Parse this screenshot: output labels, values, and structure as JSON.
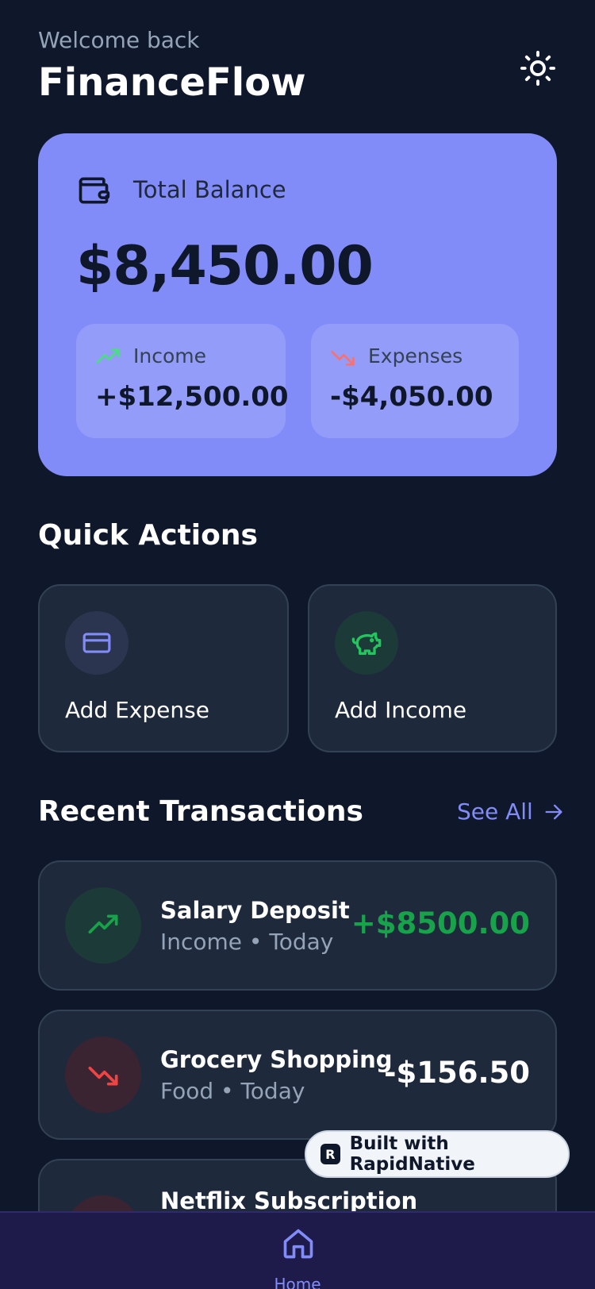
{
  "header": {
    "welcome": "Welcome back",
    "title": "FinanceFlow",
    "theme_icon": "sun-icon"
  },
  "balance": {
    "label": "Total Balance",
    "amount": "$8,450.00",
    "income_label": "Income",
    "income_value": "+$12,500.00",
    "expenses_label": "Expenses",
    "expenses_value": "-$4,050.00"
  },
  "quick_actions": {
    "title": "Quick Actions",
    "items": [
      {
        "label": "Add Expense",
        "icon": "credit-card-icon"
      },
      {
        "label": "Add Income",
        "icon": "piggy-bank-icon"
      }
    ]
  },
  "transactions": {
    "title": "Recent Transactions",
    "see_all": "See All",
    "items": [
      {
        "title": "Salary Deposit",
        "subtitle": "Income • Today",
        "amount": "+$8500.00",
        "type": "income"
      },
      {
        "title": "Grocery Shopping",
        "subtitle": "Food • Today",
        "amount": "-$156.50",
        "type": "expense"
      },
      {
        "title": "Netflix Subscription",
        "subtitle": "",
        "amount": "",
        "type": "expense"
      }
    ]
  },
  "badge": {
    "label": "Built with RapidNative"
  },
  "nav": {
    "home_label": "Home"
  },
  "colors": {
    "background": "#0f172a",
    "card": "#1e293b",
    "accent": "#818cf8",
    "balance_card": "#828cf8",
    "positive": "#16a34a",
    "negative": "#ef4444"
  }
}
